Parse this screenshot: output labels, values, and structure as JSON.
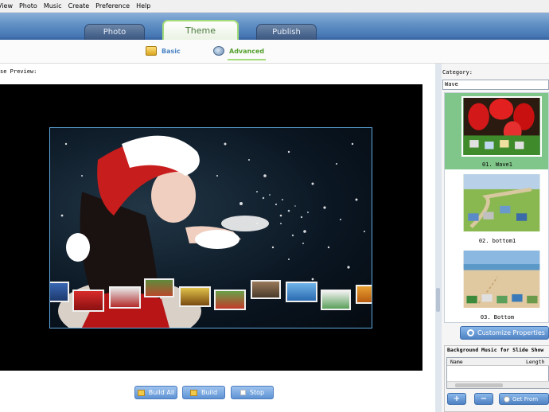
{
  "menu": {
    "items": [
      "View",
      "Photo",
      "Music",
      "Create",
      "Preference",
      "Help"
    ]
  },
  "tabs": [
    {
      "label": "Photo"
    },
    {
      "label": "Theme"
    },
    {
      "label": "Publish"
    }
  ],
  "subtabs": {
    "basic": "Basic",
    "advanced": "Advanced"
  },
  "preview": {
    "label": "se Preview:"
  },
  "controls": {
    "build_all": "Build All",
    "build": "Build",
    "stop": "Stop"
  },
  "sidebar": {
    "category_label": "Category:",
    "category_value": "Wave",
    "themes": [
      {
        "caption": "01. Wave1"
      },
      {
        "caption": "02. bottom1"
      },
      {
        "caption": "03. Bottom"
      }
    ],
    "customize_label": "Customize Properties",
    "music": {
      "title": "Background Music for Slide Show",
      "col_name": "Name",
      "col_length": "Length",
      "add": "+",
      "remove": "−",
      "get_from": "Get From"
    }
  },
  "colors": {
    "accent_green": "#a5dc7a",
    "tab_blue": "#3d6fad",
    "selected_theme_bg": "#80c68a"
  }
}
